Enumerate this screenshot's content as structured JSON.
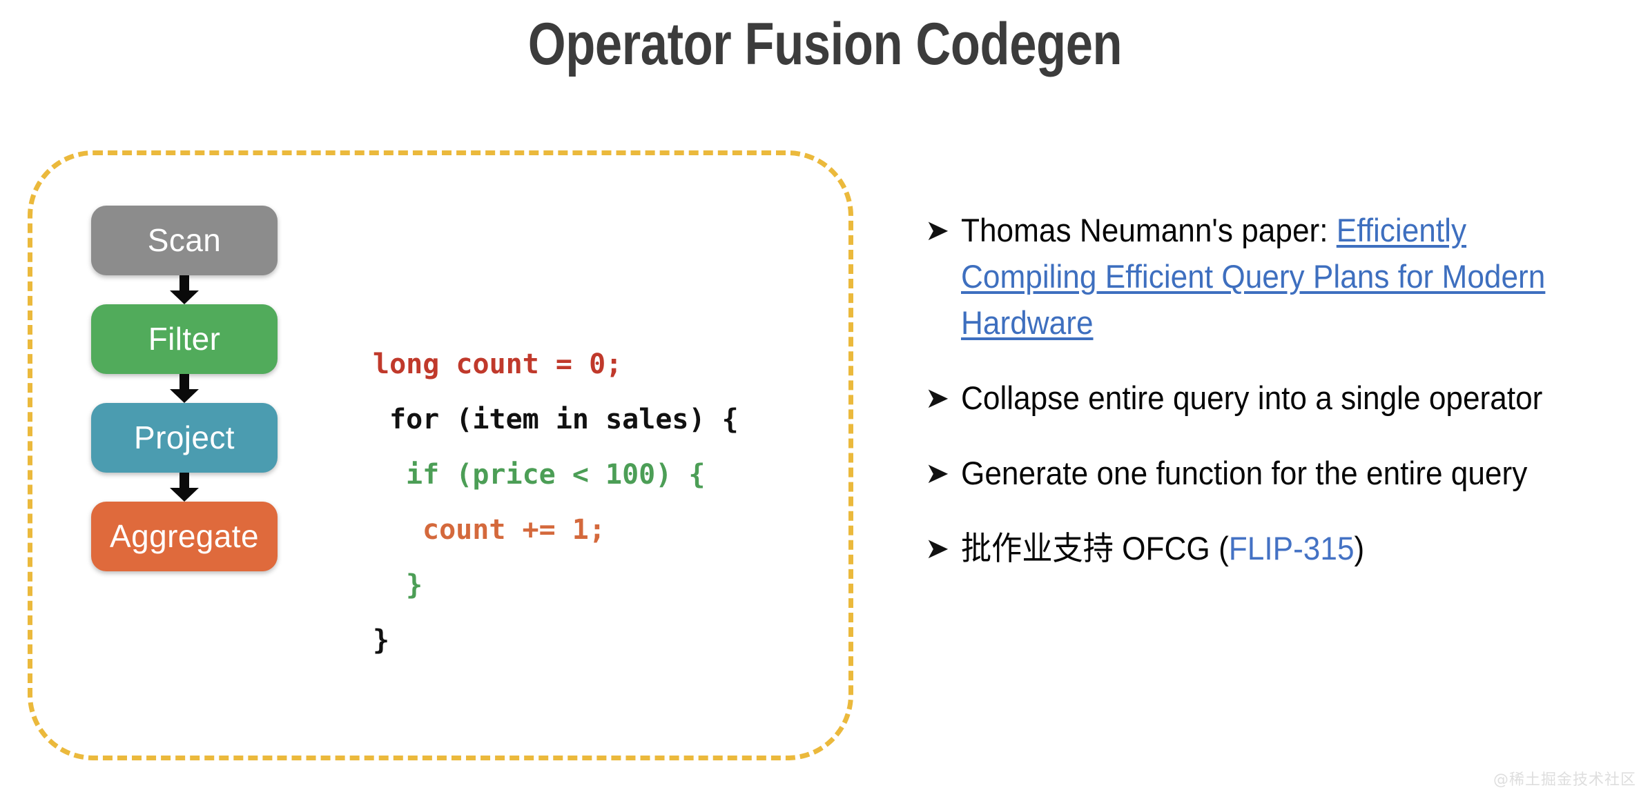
{
  "slide": {
    "title": "Operator Fusion Codegen",
    "title_color": "#3c3c3c",
    "background": "#ffffff"
  },
  "fusion_region": {
    "border_color": "#ebb93c",
    "border_style": "dashed",
    "label": "fused-operator-region"
  },
  "pipeline": {
    "name": "query-operator-pipeline",
    "boxes": [
      {
        "label": "Scan",
        "color": "#8c8c8c",
        "icon": "scan-operator-box"
      },
      {
        "label": "Filter",
        "color": "#51ab5b",
        "icon": "filter-operator-box"
      },
      {
        "label": "Project",
        "color": "#4b9cb0",
        "icon": "project-operator-box"
      },
      {
        "label": "Aggregate",
        "color": "#df6a3c",
        "icon": "aggregate-operator-box"
      }
    ],
    "arrow_color": "#0a0a0a",
    "arrow_count": 3
  },
  "code": {
    "language": "java-like-pseudocode",
    "lines": [
      {
        "text": "long count = 0;",
        "indent": 0,
        "color": "#c0392b"
      },
      {
        "text": "for (item in sales) {",
        "indent": 1,
        "color": "#111111"
      },
      {
        "text": "if (price < 100) {",
        "indent": 2,
        "color": "#4c9e56"
      },
      {
        "text": "count += 1;",
        "indent": 3,
        "color": "#d4693c"
      },
      {
        "text": "}",
        "indent": 2,
        "color": "#4c9e56"
      },
      {
        "text": "}",
        "indent": 0,
        "color": "#111111"
      }
    ]
  },
  "bullets": {
    "marker_glyph": "➤",
    "items": [
      {
        "name": "bullet-paper-reference",
        "segments": [
          {
            "text": "Thomas Neumann's paper: ",
            "style": "plain"
          },
          {
            "text": "Efficiently Compiling Efficient Query Plans for Modern Hardware",
            "style": "link"
          }
        ]
      },
      {
        "name": "bullet-collapse-query",
        "segments": [
          {
            "text": "Collapse entire query into a single operator",
            "style": "plain"
          }
        ]
      },
      {
        "name": "bullet-generate-function",
        "segments": [
          {
            "text": "Generate one function for the entire query",
            "style": "plain"
          }
        ]
      },
      {
        "name": "bullet-batch-ofcg",
        "segments": [
          {
            "text": "批作业支持 OFCG (",
            "style": "plain"
          },
          {
            "text": "FLIP-315",
            "style": "link-plain"
          },
          {
            "text": ")",
            "style": "plain"
          }
        ]
      }
    ],
    "link_color": "#3e6fbf",
    "link_plain_color": "#4472c4"
  },
  "watermark": {
    "text": "@稀土掘金技术社区",
    "color": "#dedede"
  }
}
